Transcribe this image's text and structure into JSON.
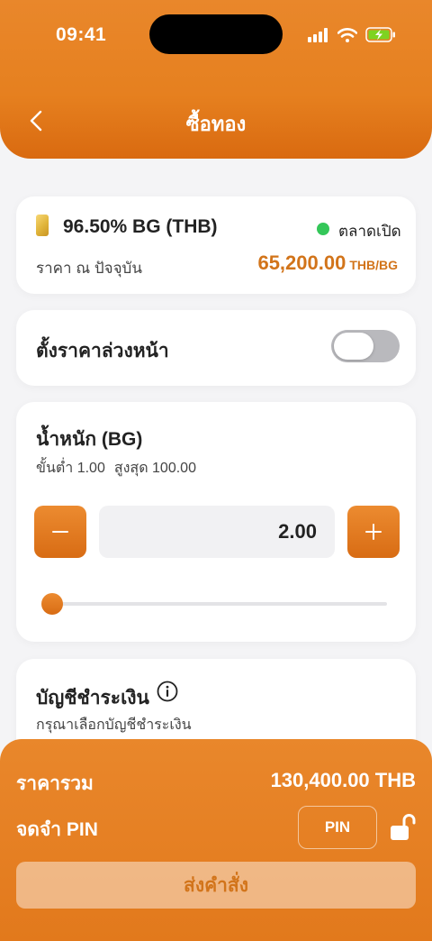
{
  "status_bar": {
    "time": "09:41"
  },
  "header": {
    "title": "ซื้อทอง"
  },
  "price_card": {
    "product": "96.50% BG (THB)",
    "market_status": "ตลาดเปิด",
    "price_label": "ราคา ณ ปัจจุบัน",
    "price": "65,200.00",
    "price_unit": "THB/BG"
  },
  "advance_order": {
    "label": "ตั้งราคาล่วงหน้า",
    "enabled": false
  },
  "weight": {
    "title": "น้ำหนัก (BG)",
    "min_label": "ขั้นต่ำ 1.00",
    "max_label": "สูงสุด 100.00",
    "min": 1.0,
    "max": 100.0,
    "value": "2.00",
    "numeric_value": 2.0
  },
  "account": {
    "title": "บัญชีชำระเงิน",
    "hint": "กรุณาเลือกบัญชีชำระเงิน"
  },
  "summary": {
    "total_label": "ราคารวม",
    "total_value": "130,400.00 THB",
    "pin_label": "จดจำ PIN",
    "pin_button": "PIN",
    "submit": "ส่งคำสั่ง"
  },
  "colors": {
    "accent": "#e6801f",
    "price": "#d2741a",
    "market_open": "#34c759"
  }
}
